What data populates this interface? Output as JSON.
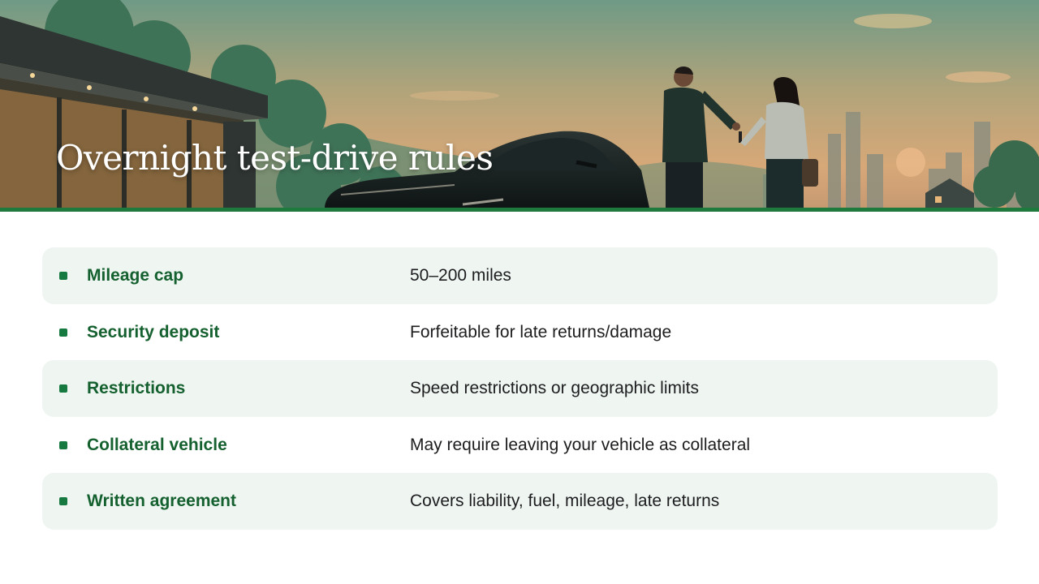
{
  "slide": {
    "title": "Overnight test-drive rules",
    "accent_color": "#1f7a3d",
    "label_color": "#15602f"
  },
  "banner": {
    "scene": "dealer-handing-car-keys-to-customer-at-dusk"
  },
  "rules": [
    {
      "label": "Mileage cap",
      "value": "50–200 miles"
    },
    {
      "label": "Security deposit",
      "value": "Forfeitable for late returns/damage"
    },
    {
      "label": "Restrictions",
      "value": "Speed restrictions or geographic limits"
    },
    {
      "label": "Collateral vehicle",
      "value": "May require leaving your vehicle as collateral"
    },
    {
      "label": "Written agreement",
      "value": "Covers liability, fuel, mileage, late returns"
    }
  ]
}
